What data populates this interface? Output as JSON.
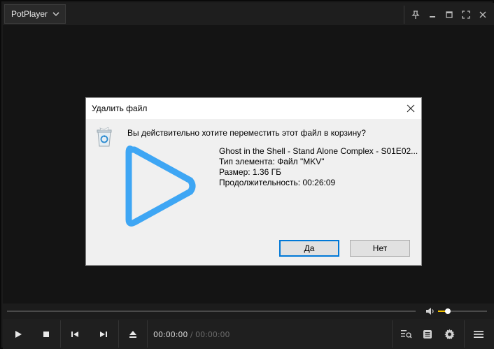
{
  "titlebar": {
    "app_name": "PotPlayer",
    "icons": [
      "chevron-down-icon",
      "pin-icon",
      "minimize-icon",
      "maximize-icon",
      "fullscreen-icon",
      "close-icon"
    ]
  },
  "dialog": {
    "title": "Удалить файл",
    "question": "Вы действительно хотите переместить этот файл в корзину?",
    "file_name": "Ghost in the Shell - Stand Alone Complex - S01E02...",
    "file_type": "Тип элемента: Файл \"MKV\"",
    "file_size": "Размер: 1.36 ГБ",
    "duration": "Продолжительность: 00:26:09",
    "yes_label": "Да",
    "no_label": "Нет"
  },
  "playback": {
    "current_time": "00:00:00",
    "separator": "/",
    "total_time": "00:00:00",
    "seek_progress": 0,
    "volume_level": 0.2
  },
  "colors": {
    "accent_volume": "#f2c200",
    "play_icon_blue": "#3ea6f4",
    "dialog_default_border": "#0078d7"
  }
}
